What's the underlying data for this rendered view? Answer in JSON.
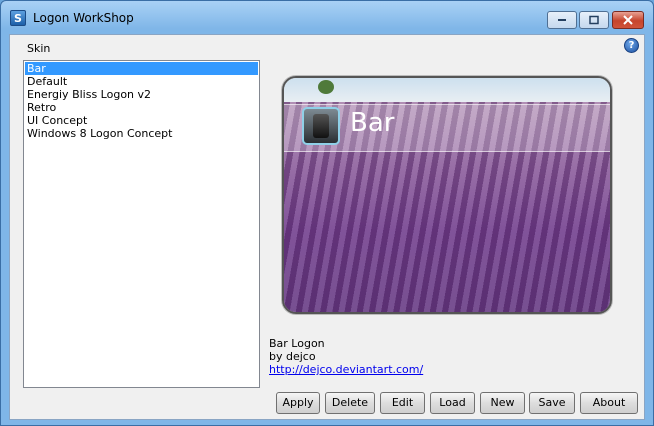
{
  "window": {
    "title": "Logon WorkShop"
  },
  "skin": {
    "label": "Skin",
    "items": [
      "Bar",
      "Default",
      "Energiy Bliss Logon v2",
      "Retro",
      "UI Concept",
      "Windows 8 Logon Concept"
    ],
    "selected": "Bar"
  },
  "preview": {
    "title": "Bar"
  },
  "info": {
    "name": "Bar Logon",
    "author": "by dejco",
    "link": "http://dejco.deviantart.com/"
  },
  "buttons": {
    "apply": "Apply",
    "delete": "Delete",
    "edit": "Edit",
    "load": "Load",
    "new": "New",
    "save": "Save",
    "about": "About"
  },
  "icons": {
    "app": "app-icon",
    "help": "help-icon",
    "minimize": "minimize-icon",
    "maximize": "maximize-icon",
    "close": "close-icon"
  },
  "colors": {
    "selection": "#3399ff",
    "link": "#0000ee"
  }
}
